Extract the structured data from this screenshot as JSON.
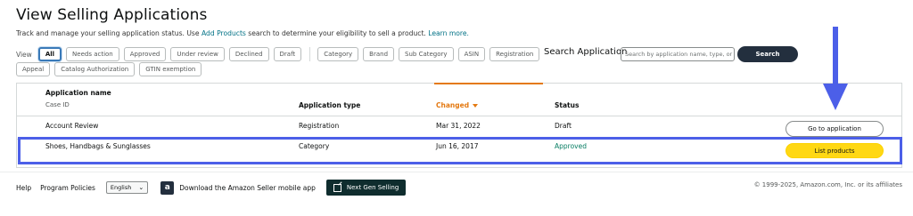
{
  "header": {
    "title": "View Selling Applications",
    "subtitle_pre": "Track and manage your selling application status. Use ",
    "subtitle_link": "Add Products",
    "subtitle_mid": " search to determine your eligibility to sell a product. ",
    "learn_more": "Learn more."
  },
  "filters": {
    "view_label": "View",
    "status_pills": [
      "All",
      "Needs action",
      "Approved",
      "Under review",
      "Declined",
      "Draft"
    ],
    "type_pills": [
      "Category",
      "Brand",
      "Sub Category",
      "ASIN",
      "Registration"
    ],
    "row2_pills": [
      "Appeal",
      "Catalog Authorization",
      "GTIN exemption"
    ],
    "active": "All"
  },
  "search": {
    "label": "Search Application",
    "placeholder": "Search by application name, type, or",
    "button": "Search"
  },
  "table": {
    "col_name": "Application name",
    "col_case": "Case ID",
    "col_type": "Application type",
    "col_changed": "Changed",
    "col_status": "Status",
    "rows": [
      {
        "name": "Account Review",
        "type": "Registration",
        "changed": "Mar 31, 2022",
        "status": "Draft",
        "action": "Go to application"
      },
      {
        "name": "Shoes, Handbags & Sunglasses",
        "type": "Category",
        "changed": "Jun 16, 2017",
        "status": "Approved",
        "action": "List products"
      }
    ]
  },
  "footer": {
    "help": "Help",
    "policies": "Program Policies",
    "language": "English",
    "app_download": "Download the Amazon Seller mobile app",
    "next_gen": "Next Gen Selling",
    "copyright": "© 1999-2025, Amazon.com, Inc. or its affiliates"
  },
  "colors": {
    "accent_orange": "#e47911",
    "approved_green": "#067d62",
    "highlight_blue": "#4c5fe8",
    "primary_yellow": "#ffd814",
    "dark_button": "#232f3e"
  },
  "icons": {
    "arrow": "arrow-down-icon",
    "app": "amazon-app-icon",
    "external": "external-link-icon"
  }
}
